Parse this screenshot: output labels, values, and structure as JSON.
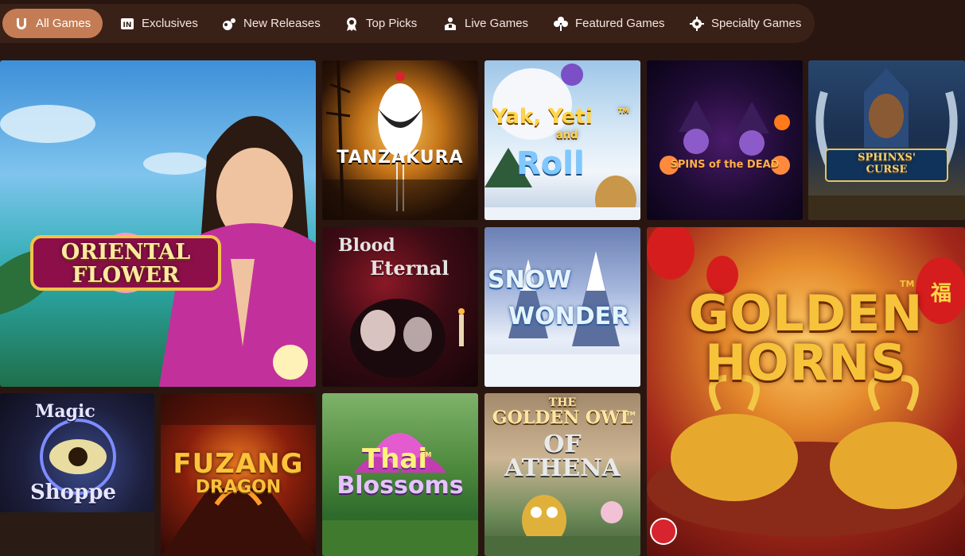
{
  "tabs": [
    {
      "label": "All Games",
      "icon": "horseshoe-icon",
      "active": true
    },
    {
      "label": "Exclusives",
      "icon": "exclusive-badge-icon",
      "active": false
    },
    {
      "label": "New Releases",
      "icon": "sparkle-icon",
      "active": false
    },
    {
      "label": "Top Picks",
      "icon": "award-ribbon-icon",
      "active": false
    },
    {
      "label": "Live Games",
      "icon": "dealer-icon",
      "active": false
    },
    {
      "label": "Featured Games",
      "icon": "clover-icon",
      "active": false
    },
    {
      "label": "Specialty Games",
      "icon": "gear-icon",
      "active": false
    }
  ],
  "games": {
    "oriental_flower": {
      "line1": "ORIENTAL",
      "line2": "FLOWER"
    },
    "tanzakura": {
      "title": "TANZAKURA"
    },
    "yak_yeti_roll": {
      "line1": "Yak, Yeti",
      "line2": "and",
      "line3": "Roll",
      "tm": "TM"
    },
    "spins_of_the_dead": {
      "title": "SPINS of the DEAD"
    },
    "sphinxs_curse": {
      "line1": "SPHINXS'",
      "line2": "CURSE"
    },
    "blood_eternal": {
      "line1": "Blood",
      "line2": "Eternal"
    },
    "snow_wonder": {
      "line1": "SNOW",
      "line2": "WONDER"
    },
    "golden_horns": {
      "line1": "GOLDEN",
      "line2": "HORNS",
      "tm": "TM",
      "lantern_char": "福"
    },
    "magic_shoppe": {
      "line1": "Magic",
      "line2": "Shoppe"
    },
    "fuzang_dragon": {
      "line1": "FUZANG",
      "line2": "DRAGON"
    },
    "thai_blossoms": {
      "line1": "Thai",
      "line2": "Blossoms",
      "tm": "TM"
    },
    "golden_owl": {
      "line1": "THE",
      "line2": "GOLDEN OWL",
      "line3": "OF ATHENA",
      "tm": "TM"
    }
  },
  "colors": {
    "page_bg": "#2a1611",
    "tabbar_bg": "#3a2118",
    "active_tab": "#c47c55",
    "tab_text": "#f3e6df"
  }
}
